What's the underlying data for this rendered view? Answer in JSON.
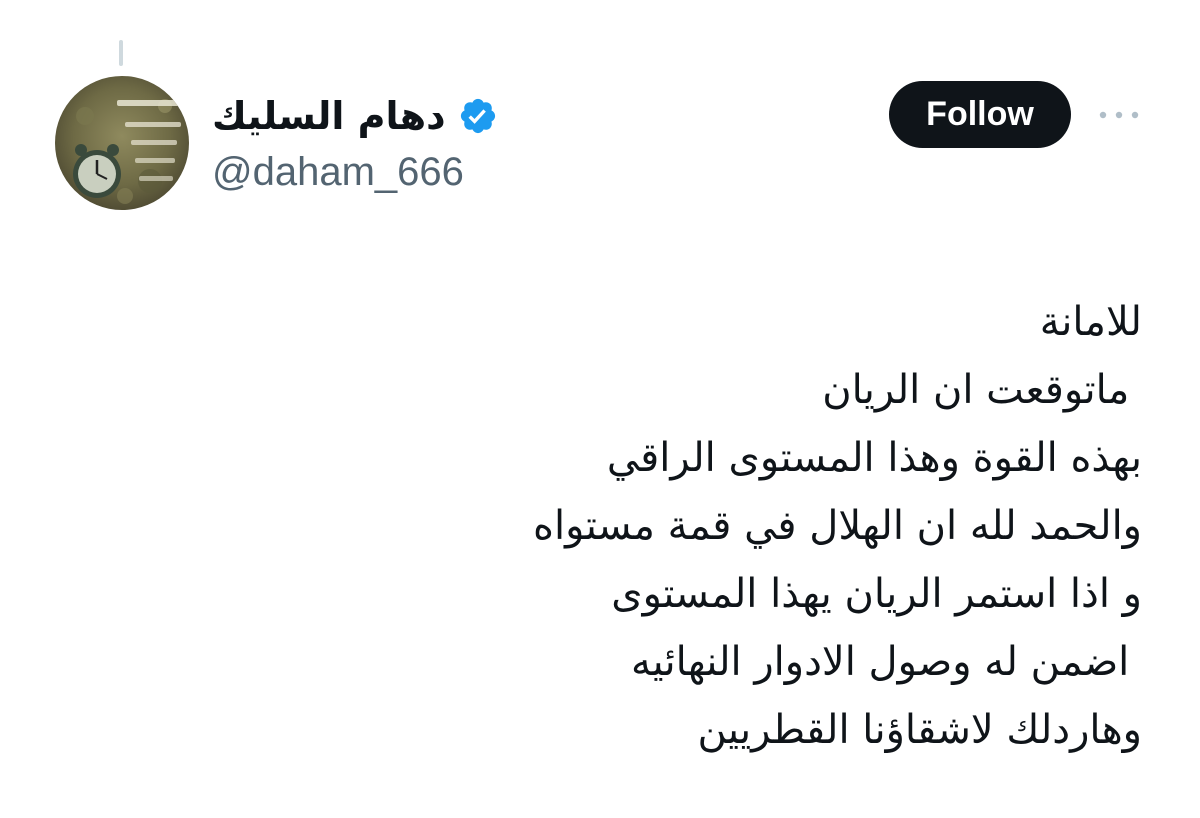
{
  "author": {
    "display_name": "دهام السليك",
    "handle": "@daham_666",
    "verified": true,
    "verified_icon": "verified-badge-icon",
    "verified_color": "#1d9bf0",
    "avatar_icon": "clock-avatar-image"
  },
  "actions": {
    "follow_label": "Follow",
    "more_icon": "more-options-icon"
  },
  "tweet": {
    "lines": [
      "للامانة",
      " ماتوقعت ان الريان",
      "بهذه القوة وهذا المستوى الراقي",
      "والحمد لله ان الهلال في قمة مستواه",
      "و اذا استمر الريان يهذا المستوى",
      " اضمن له وصول الادوار النهائيه",
      "وهاردلك لاشقاؤنا القطريين"
    ]
  },
  "colors": {
    "text_primary": "#0f1419",
    "text_secondary": "#536471",
    "follow_bg": "#0f1419",
    "follow_text": "#ffffff",
    "more_dots": "#b0bec8"
  }
}
